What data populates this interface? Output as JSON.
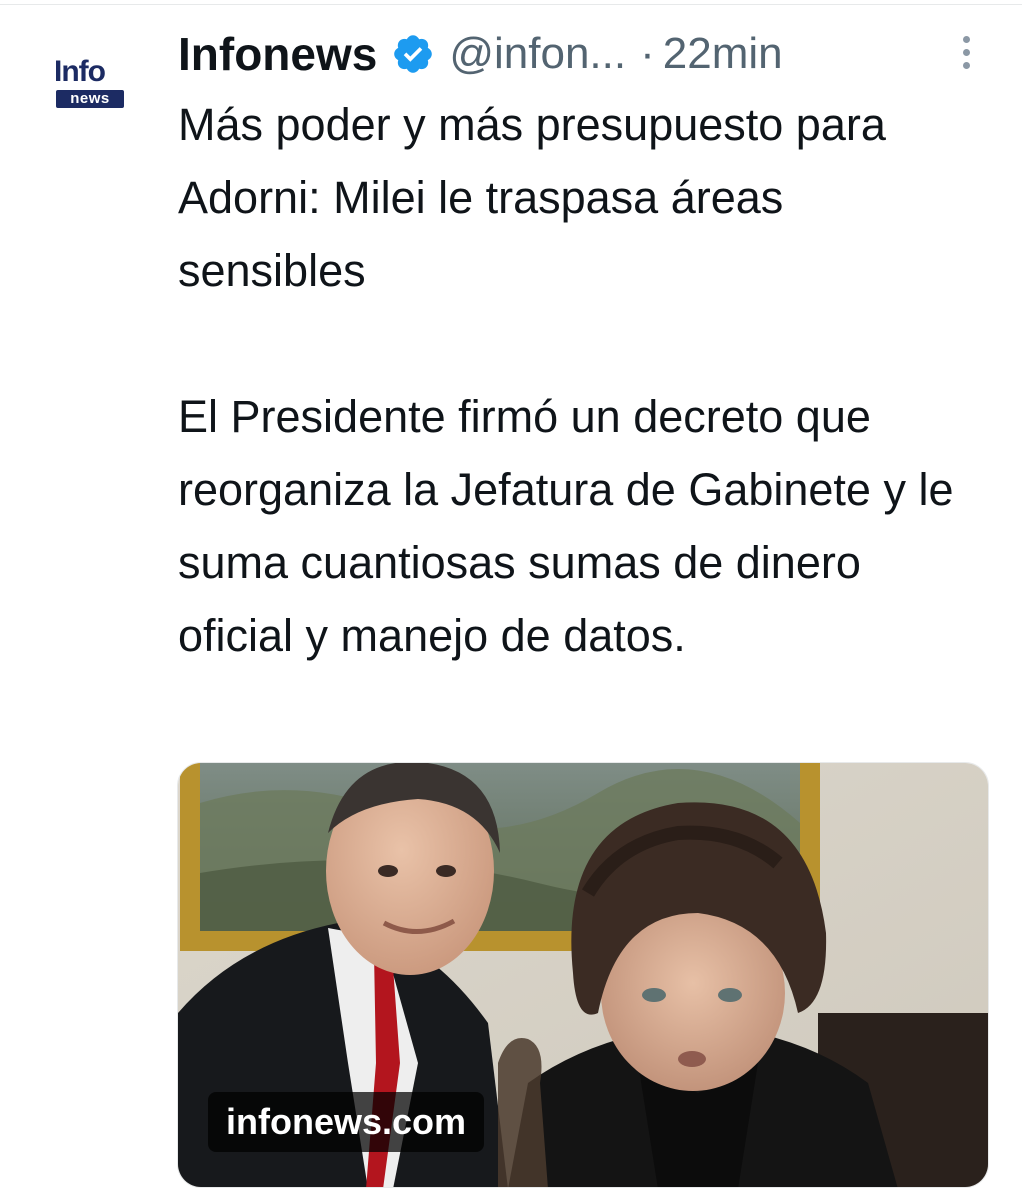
{
  "account": {
    "logo_top": "Info",
    "logo_bottom": "news",
    "display_name": "Infonews",
    "handle": "@infon...",
    "separator": "·",
    "time": "22min",
    "verified_icon": "verified-badge-icon",
    "verified_color": "#1d9bf0"
  },
  "tweet": {
    "paragraphs": [
      "Más poder y más presupuesto para Adorni: Milei le traspasa áreas sensibles",
      "El Presidente firmó un decreto que reorganiza la Jefatura de Gabinete y le suma cuantiosas sumas de dinero oficial y manejo de datos."
    ]
  },
  "media": {
    "link_domain": "infonews.com"
  },
  "colors": {
    "text": "#0f1419",
    "secondary": "#536471",
    "logo_navy": "#1c2b63"
  }
}
